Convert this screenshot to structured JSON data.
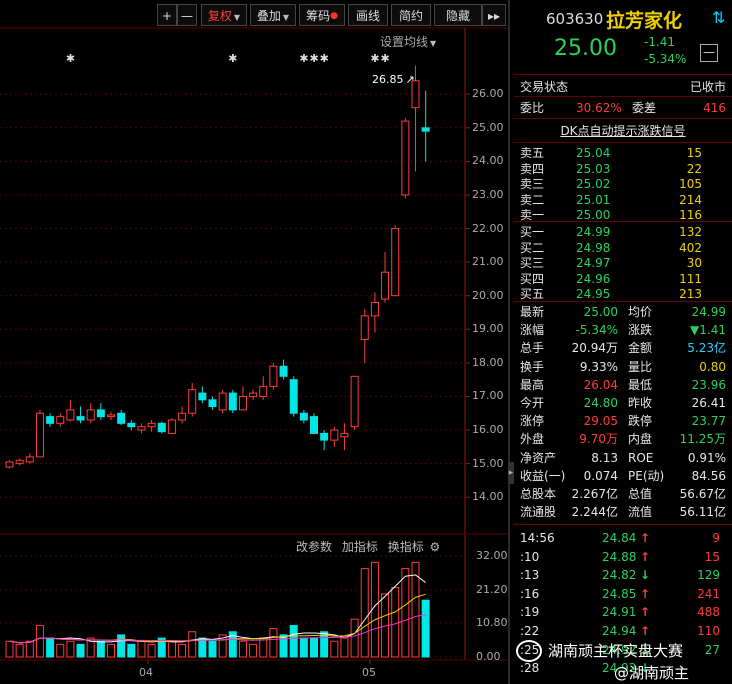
{
  "toolbar": {
    "plus": "+",
    "minus": "—",
    "fuquan": "复权",
    "diejia": "叠加",
    "chouma": "筹码",
    "huaxian": "画线",
    "jianyue": "简约",
    "yincang": "隐藏",
    "more": "▸▸"
  },
  "chart": {
    "settings_label": "设置均线",
    "high_marker": "26.85",
    "price_ticks": [
      "26.00",
      "25.00",
      "24.00",
      "23.00",
      "22.00",
      "21.00",
      "20.00",
      "19.00",
      "18.00",
      "17.00",
      "16.00",
      "15.00",
      "14.00"
    ],
    "indicator_buttons": [
      "改参数",
      "加指标",
      "换指标"
    ],
    "volume_ticks": [
      "32.00",
      "21.20",
      "10.80",
      "0.00"
    ],
    "months": [
      "04",
      "05"
    ]
  },
  "chart_data": {
    "type": "candlestick",
    "price_ylim": [
      13.5,
      26.9
    ],
    "volume_ylim": [
      0,
      32
    ],
    "candles": [
      {
        "o": 14.9,
        "c": 15.05,
        "h": 15.1,
        "l": 14.85,
        "v": 5
      },
      {
        "o": 15.0,
        "c": 15.1,
        "h": 15.15,
        "l": 14.95,
        "v": 4
      },
      {
        "o": 15.05,
        "c": 15.2,
        "h": 15.3,
        "l": 15.0,
        "v": 5
      },
      {
        "o": 15.2,
        "c": 16.5,
        "h": 16.6,
        "l": 15.2,
        "v": 10
      },
      {
        "o": 16.4,
        "c": 16.2,
        "h": 16.5,
        "l": 16.1,
        "v": 6
      },
      {
        "o": 16.2,
        "c": 16.4,
        "h": 16.5,
        "l": 16.1,
        "v": 4
      },
      {
        "o": 16.3,
        "c": 16.6,
        "h": 16.9,
        "l": 16.25,
        "v": 5
      },
      {
        "o": 16.4,
        "c": 16.3,
        "h": 16.7,
        "l": 16.2,
        "v": 4
      },
      {
        "o": 16.3,
        "c": 16.6,
        "h": 16.8,
        "l": 16.2,
        "v": 6
      },
      {
        "o": 16.6,
        "c": 16.4,
        "h": 16.8,
        "l": 16.3,
        "v": 5
      },
      {
        "o": 16.4,
        "c": 16.45,
        "h": 16.55,
        "l": 16.3,
        "v": 4
      },
      {
        "o": 16.5,
        "c": 16.2,
        "h": 16.6,
        "l": 16.15,
        "v": 7
      },
      {
        "o": 16.2,
        "c": 16.1,
        "h": 16.3,
        "l": 16.0,
        "v": 4
      },
      {
        "o": 16.0,
        "c": 16.1,
        "h": 16.2,
        "l": 15.9,
        "v": 5
      },
      {
        "o": 16.1,
        "c": 16.2,
        "h": 16.3,
        "l": 15.95,
        "v": 4
      },
      {
        "o": 16.2,
        "c": 15.95,
        "h": 16.25,
        "l": 15.9,
        "v": 6
      },
      {
        "o": 15.9,
        "c": 16.3,
        "h": 16.35,
        "l": 15.9,
        "v": 5
      },
      {
        "o": 16.3,
        "c": 16.5,
        "h": 16.7,
        "l": 16.2,
        "v": 4
      },
      {
        "o": 16.5,
        "c": 17.2,
        "h": 17.4,
        "l": 16.4,
        "v": 8
      },
      {
        "o": 17.1,
        "c": 16.9,
        "h": 17.3,
        "l": 16.8,
        "v": 6
      },
      {
        "o": 16.9,
        "c": 16.7,
        "h": 17.0,
        "l": 16.6,
        "v": 5
      },
      {
        "o": 16.6,
        "c": 17.1,
        "h": 17.2,
        "l": 16.5,
        "v": 7
      },
      {
        "o": 17.1,
        "c": 16.6,
        "h": 17.2,
        "l": 16.5,
        "v": 8
      },
      {
        "o": 16.6,
        "c": 17.0,
        "h": 17.3,
        "l": 16.6,
        "v": 5
      },
      {
        "o": 17.0,
        "c": 17.1,
        "h": 17.2,
        "l": 16.9,
        "v": 4
      },
      {
        "o": 17.0,
        "c": 17.3,
        "h": 17.6,
        "l": 16.9,
        "v": 6
      },
      {
        "o": 17.3,
        "c": 17.9,
        "h": 18.0,
        "l": 17.2,
        "v": 9
      },
      {
        "o": 17.9,
        "c": 17.6,
        "h": 18.1,
        "l": 17.5,
        "v": 7
      },
      {
        "o": 17.5,
        "c": 16.5,
        "h": 17.6,
        "l": 16.4,
        "v": 10
      },
      {
        "o": 16.5,
        "c": 16.3,
        "h": 16.6,
        "l": 16.2,
        "v": 6
      },
      {
        "o": 16.4,
        "c": 15.9,
        "h": 16.5,
        "l": 15.9,
        "v": 6
      },
      {
        "o": 15.9,
        "c": 15.7,
        "h": 16.0,
        "l": 15.4,
        "v": 8
      },
      {
        "o": 15.7,
        "c": 16.0,
        "h": 16.1,
        "l": 15.5,
        "v": 5
      },
      {
        "o": 15.8,
        "c": 15.9,
        "h": 16.2,
        "l": 15.4,
        "v": 6
      },
      {
        "o": 16.1,
        "c": 17.6,
        "h": 17.6,
        "l": 16.0,
        "v": 12
      },
      {
        "o": 18.7,
        "c": 19.4,
        "h": 19.6,
        "l": 18.0,
        "v": 28
      },
      {
        "o": 19.4,
        "c": 19.8,
        "h": 20.1,
        "l": 18.9,
        "v": 30
      },
      {
        "o": 19.9,
        "c": 20.7,
        "h": 21.3,
        "l": 19.8,
        "v": 20
      },
      {
        "o": 20.0,
        "c": 22.0,
        "h": 22.1,
        "l": 20.0,
        "v": 22
      },
      {
        "o": 23.0,
        "c": 25.2,
        "h": 25.3,
        "l": 22.9,
        "v": 28
      },
      {
        "o": 25.6,
        "c": 26.4,
        "h": 26.85,
        "l": 23.7,
        "v": 30
      },
      {
        "o": 25.0,
        "c": 24.9,
        "h": 26.1,
        "l": 24.0,
        "v": 18
      }
    ],
    "stars_at": [
      6,
      22,
      29,
      30,
      31,
      36,
      37
    ]
  },
  "quote": {
    "code": "603630",
    "name": "拉芳家化",
    "price": "25.00",
    "change": "-1.41",
    "change_pct": "-5.34%",
    "trade_status_label": "交易状态",
    "trade_status_value": "已收市",
    "weibi_label": "委比",
    "weibi_value": "30.62%",
    "weicha_label": "委差",
    "weicha_value": "416",
    "signal_link": "DK点自动提示涨跌信号",
    "asks": [
      {
        "label": "卖五",
        "price": "25.04",
        "vol": "15"
      },
      {
        "label": "卖四",
        "price": "25.03",
        "vol": "22"
      },
      {
        "label": "卖三",
        "price": "25.02",
        "vol": "105"
      },
      {
        "label": "卖二",
        "price": "25.01",
        "vol": "214"
      },
      {
        "label": "卖一",
        "price": "25.00",
        "vol": "116"
      }
    ],
    "bids": [
      {
        "label": "买一",
        "price": "24.99",
        "vol": "132"
      },
      {
        "label": "买二",
        "price": "24.98",
        "vol": "402"
      },
      {
        "label": "买三",
        "price": "24.97",
        "vol": "30"
      },
      {
        "label": "买四",
        "price": "24.96",
        "vol": "111"
      },
      {
        "label": "买五",
        "price": "24.95",
        "vol": "213"
      }
    ],
    "stats": [
      {
        "l1": "最新",
        "v1": "25.00",
        "c1": "grn",
        "l2": "均价",
        "v2": "24.99",
        "c2": "grn"
      },
      {
        "l1": "涨幅",
        "v1": "-5.34%",
        "c1": "grn",
        "l2": "涨跌",
        "v2": "▼1.41",
        "c2": "grn"
      },
      {
        "l1": "总手",
        "v1": "20.94万",
        "c1": "wht",
        "l2": "金额",
        "v2": "5.23亿",
        "c2": "cyan"
      },
      {
        "l1": "换手",
        "v1": "9.33%",
        "c1": "wht",
        "l2": "量比",
        "v2": "0.80",
        "c2": "yel"
      },
      {
        "l1": "最高",
        "v1": "26.04",
        "c1": "red",
        "l2": "最低",
        "v2": "23.96",
        "c2": "grn"
      },
      {
        "l1": "今开",
        "v1": "24.80",
        "c1": "grn",
        "l2": "昨收",
        "v2": "26.41",
        "c2": "wht"
      },
      {
        "l1": "涨停",
        "v1": "29.05",
        "c1": "red",
        "l2": "跌停",
        "v2": "23.77",
        "c2": "grn"
      },
      {
        "l1": "外盘",
        "v1": "9.70万",
        "c1": "red",
        "l2": "内盘",
        "v2": "11.25万",
        "c2": "grn"
      },
      {
        "l1": "净资产",
        "v1": "8.13",
        "c1": "wht",
        "l2": "ROE",
        "v2": "0.91%",
        "c2": "wht"
      },
      {
        "l1": "收益(一)",
        "v1": "0.074",
        "c1": "wht",
        "l2": "PE(动)",
        "v2": "84.56",
        "c2": "wht"
      },
      {
        "l1": "总股本",
        "v1": "2.267亿",
        "c1": "wht",
        "l2": "总值",
        "v2": "56.67亿",
        "c2": "wht"
      },
      {
        "l1": "流通股",
        "v1": "2.244亿",
        "c1": "wht",
        "l2": "流值",
        "v2": "56.11亿",
        "c2": "wht"
      }
    ],
    "ticks": [
      {
        "time": "14:56",
        "price": "24.84",
        "dir": "up",
        "vol": "9"
      },
      {
        "time": ":10",
        "price": "24.88",
        "dir": "up",
        "vol": "15"
      },
      {
        "time": ":13",
        "price": "24.82",
        "dir": "down",
        "vol": "129"
      },
      {
        "time": ":16",
        "price": "24.85",
        "dir": "up",
        "vol": "241"
      },
      {
        "time": ":19",
        "price": "24.91",
        "dir": "up",
        "vol": "488"
      },
      {
        "time": ":22",
        "price": "24.94",
        "dir": "up",
        "vol": "110"
      },
      {
        "time": ":25",
        "price": "24.92",
        "dir": "down",
        "vol": "27"
      },
      {
        "time": ":28",
        "price": "24.92",
        "dir": "down",
        "vol": ""
      }
    ],
    "watermark1": "湖南顽主杯实盘大赛",
    "watermark2": "@湖南顽主"
  },
  "colors": {
    "up": "#ff3b3b",
    "down": "#00e5e5",
    "grid": "#5a0000",
    "price_green": "#2bd15e",
    "ma_white": "#ffffff",
    "ma_yellow": "#e8d000",
    "ma_pink": "#ff2fd0"
  }
}
